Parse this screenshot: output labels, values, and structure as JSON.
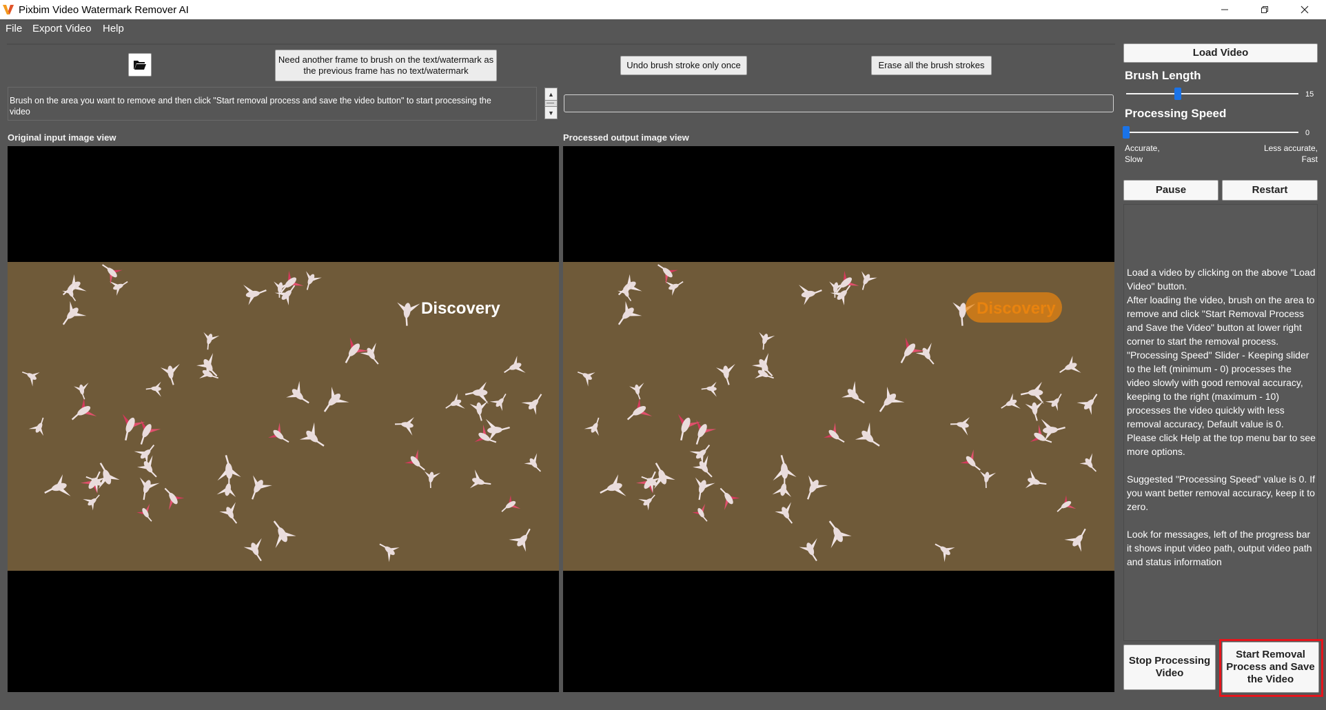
{
  "window": {
    "title": "Pixbim Video Watermark Remover AI",
    "controls": [
      "minimize-icon",
      "restore-icon",
      "close-icon"
    ]
  },
  "menu": {
    "file": "File",
    "export_video": "Export Video",
    "help": "Help"
  },
  "toolbar": {
    "open_icon": "folder-open-icon",
    "need_frame": "Need another frame to brush on the text/watermark as the previous frame has no text/watermark",
    "undo": "Undo brush stroke only once",
    "erase_all": "Erase all the brush strokes"
  },
  "message": {
    "text": "Brush on the area you want to remove and then click \"Start removal process and save the video button\" to start processing the video"
  },
  "progress": {
    "value": 0
  },
  "views": {
    "original_label": "Original input image view",
    "processed_label": "Processed output image view",
    "watermark_text": "Discovery",
    "colors": {
      "water": "#6f5a39",
      "mask": "#e8830f"
    }
  },
  "sidebar": {
    "load_video": "Load Video",
    "brush_length_label": "Brush Length",
    "brush_length_value": "15",
    "brush_length_fraction": 0.3,
    "speed_label": "Processing Speed",
    "speed_value": "0",
    "speed_fraction": 0,
    "accurate_hint": "Accurate, Slow",
    "fast_hint": "Less accurate, Fast",
    "pause": "Pause",
    "restart": "Restart",
    "info": "Load a video by clicking on the above \"Load Video\" button.\nAfter loading the video, brush on the area to remove and click \"Start Removal Process and Save the Video\" button at lower right corner to start the removal process.\n\"Processing Speed\" Slider - Keeping slider to the left (minimum - 0) processes the video slowly with good removal accuracy, keeping to the right (maximum - 10) processes the video quickly with less removal accuracy, Default value is 0.\nPlease click Help at the top menu bar to see more options.\n\nSuggested \"Processing Speed\" value is 0. If you want better removal accuracy, keep it to zero.\n\nLook for messages, left of the progress bar it shows input video path, output video path and status information",
    "stop": "Stop Processing Video",
    "start": "Start Removal Process and Save the Video",
    "accent_color": "#1a73e8",
    "highlight_color": "#e5151c"
  }
}
